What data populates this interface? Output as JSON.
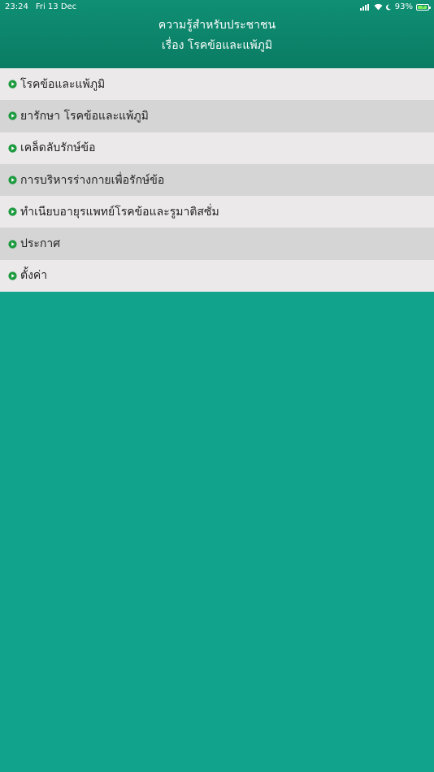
{
  "status_bar": {
    "time": "23:24",
    "date": "Fri 13 Dec",
    "battery_percent": "93%",
    "battery_level": 0.93
  },
  "header": {
    "title_line1": "ความรู้สำหรับประชาชน",
    "title_line2": "เรื่อง โรคข้อและแพ้ภูมิ"
  },
  "menu": {
    "items": [
      {
        "label": "โรคข้อและแพ้ภูมิ",
        "icon": "play-bullet-icon"
      },
      {
        "label": "ยารักษา โรคข้อและแพ้ภูมิ",
        "icon": "play-bullet-icon"
      },
      {
        "label": "เคล็ดลับรักษ์ข้อ",
        "icon": "play-bullet-icon"
      },
      {
        "label": "การบริหารร่างกายเพื่อรักษ์ข้อ",
        "icon": "play-bullet-icon"
      },
      {
        "label": "ทำเนียบอายุรแพทย์โรคข้อและรูมาติสซั่ม",
        "icon": "play-bullet-icon"
      },
      {
        "label": "ประกาศ",
        "icon": "play-bullet-icon"
      },
      {
        "label": "ตั้งค่า",
        "icon": "play-bullet-icon"
      }
    ]
  },
  "colors": {
    "header": "#0a7c63",
    "background": "#12a38c",
    "row_light": "#ebe9ea",
    "row_dark": "#d6d5d5",
    "bullet": "#1e9a40"
  }
}
